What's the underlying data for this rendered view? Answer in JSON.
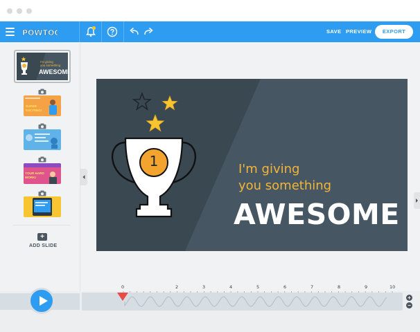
{
  "topbar": {
    "logo_text": "POWTOON",
    "save_label": "SAVE",
    "preview_label": "PREVIEW",
    "export_label": "EXPORT"
  },
  "sidebar": {
    "slides": [
      {
        "name": "slide-1",
        "lines": [
          "I'm giving",
          "you something",
          "AWESOME"
        ]
      },
      {
        "name": "slide-2",
        "lines": [
          "SUPER",
          "EXCITING!"
        ]
      },
      {
        "name": "slide-3",
        "lines": []
      },
      {
        "name": "slide-4",
        "lines": [
          "YOUR HARD",
          "WORK!"
        ]
      },
      {
        "name": "slide-5",
        "lines": []
      }
    ],
    "add_slide_label": "ADD SLIDE"
  },
  "stage": {
    "badge_number": "1",
    "line1": "I'm giving",
    "line2": "you something",
    "headline": "AWESOME"
  },
  "timeline": {
    "ticks": [
      "0",
      "2",
      "3",
      "4",
      "5",
      "6",
      "7",
      "8",
      "9",
      "10"
    ],
    "zoom_in": "+",
    "zoom_out": "−"
  },
  "colors": {
    "accent": "#2e9cf0",
    "stage_dark": "#3a4851",
    "stage_light": "#465763",
    "gold": "#f2b53a",
    "playhead": "#e94b45"
  }
}
